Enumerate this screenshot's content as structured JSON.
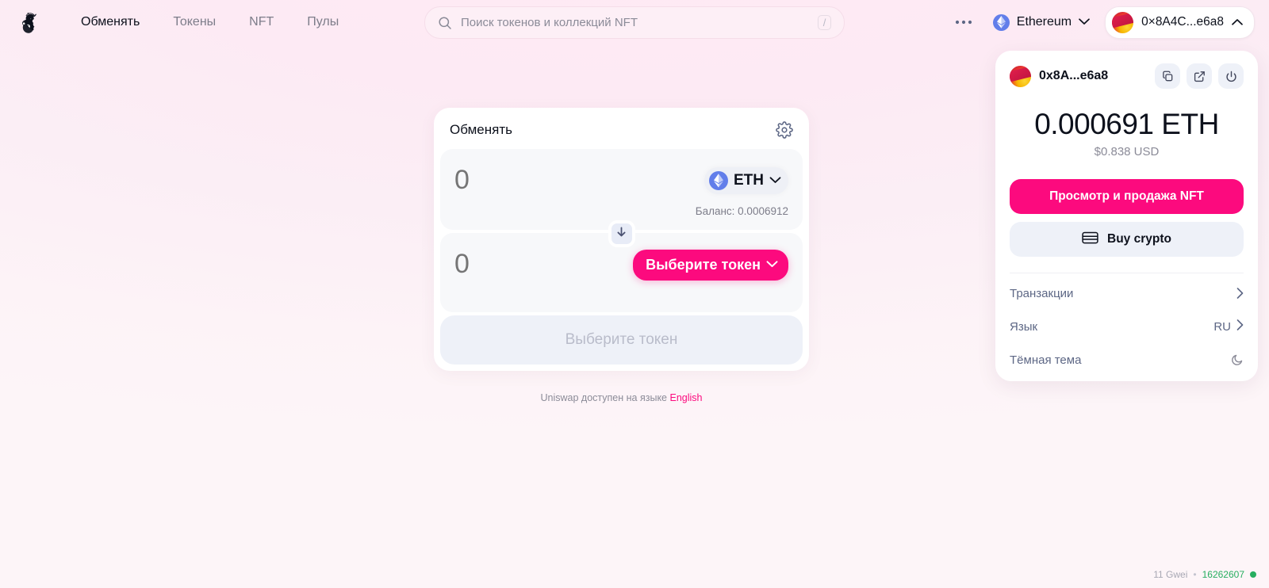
{
  "nav": {
    "logo_icon": "uniswap-unicorn-logo",
    "links": [
      {
        "label": "Обменять",
        "active": true
      },
      {
        "label": "Токены",
        "active": false
      },
      {
        "label": "NFT",
        "active": false
      },
      {
        "label": "Пулы",
        "active": false
      }
    ],
    "more_icon": "ellipsis-icon",
    "chain": {
      "name": "Ethereum",
      "icon": "ethereum-icon",
      "chevron": "chevron-down-icon"
    },
    "wallet": {
      "address": "0×8A4C...e6a8",
      "chevron": "chevron-up-icon",
      "avatar": "wallet-avatar"
    }
  },
  "search": {
    "placeholder": "Поиск токенов и коллекций NFT",
    "value": "",
    "icon": "search-icon",
    "shortcut": "/"
  },
  "swap": {
    "title": "Обменять",
    "settings_icon": "gear-icon",
    "input": {
      "amount": "0",
      "placeholder": "0",
      "token_symbol": "ETH",
      "token_icon": "ethereum-icon",
      "chevron": "chevron-down-icon",
      "balance_label": "Баланс: 0.0006912"
    },
    "toggle_icon": "arrow-down-icon",
    "output": {
      "amount": "0",
      "placeholder": "0",
      "select_token_label": "Выберите токен",
      "chevron": "chevron-down-icon"
    },
    "action_label": "Выберите токен",
    "action_disabled": true
  },
  "language_note": {
    "text": "Uniswap доступен на языке ",
    "link": "English"
  },
  "wallet_panel": {
    "address": "0x8A...e6a8",
    "avatar": "wallet-avatar",
    "actions": [
      {
        "name": "copy-icon"
      },
      {
        "name": "external-link-icon"
      },
      {
        "name": "power-icon"
      }
    ],
    "balance": "0.000691 ETH",
    "usd": "$0.838 USD",
    "nft_button": "Просмотр и продажа NFT",
    "buy_button": "Buy crypto",
    "buy_icon": "credit-card-icon",
    "menu": [
      {
        "label": "Транзакции",
        "value": "",
        "icon": "chevron-right-icon"
      },
      {
        "label": "Язык",
        "value": "RU",
        "icon": "chevron-right-icon"
      },
      {
        "label": "Тёмная тема",
        "value": "",
        "icon": "moon-icon"
      }
    ]
  },
  "status": {
    "gas": "11 Gwei",
    "separator": "•",
    "block": "16262607",
    "indicator": "green-dot"
  },
  "colors": {
    "accent_pink": "#fc0a7e",
    "background_pink": "#fdeef5",
    "ethereum_blue": "#627eea",
    "status_green": "#27ae60",
    "card_white": "#ffffff",
    "muted_text": "#7d7d8a"
  }
}
